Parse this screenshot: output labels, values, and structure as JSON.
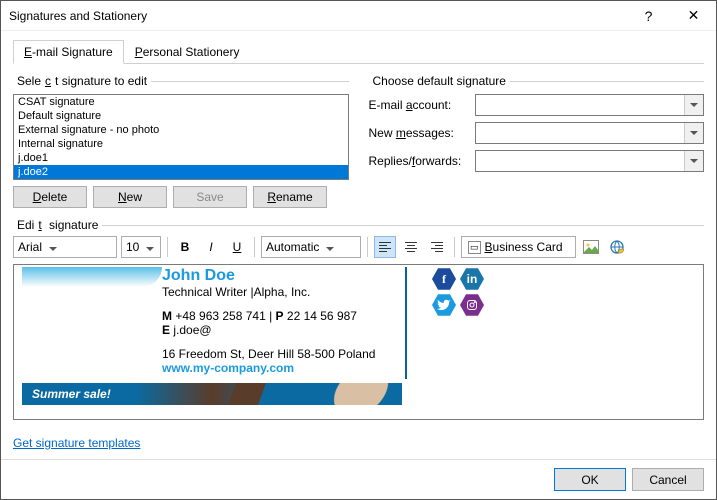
{
  "window": {
    "title": "Signatures and Stationery"
  },
  "tabs": {
    "email": "E-mail Signature",
    "stationery": "Personal Stationery"
  },
  "left_group": {
    "label": "Select signature to edit",
    "items": [
      "CSAT signature",
      "Default signature",
      "External signature - no photo",
      "Internal signature",
      "j.doe1",
      "j.doe2"
    ],
    "selected_index": 5
  },
  "buttons": {
    "delete": "Delete",
    "new": "New",
    "save": "Save",
    "rename": "Rename"
  },
  "right_group": {
    "label": "Choose default signature",
    "email_account": "E-mail account:",
    "new_messages": "New messages:",
    "replies": "Replies/forwards:"
  },
  "edit_label": "Edit signature",
  "toolbar": {
    "font": "Arial",
    "size": "10",
    "color": "Automatic",
    "bizcard": "Business Card"
  },
  "signature": {
    "name": "John Doe",
    "title": "Technical Writer |Alpha, Inc.",
    "phone_line_prefix_m": "M",
    "phone_m": " +48 963 258 741 | ",
    "phone_line_prefix_p": "P",
    "phone_p": " 22 14 56 987",
    "email_prefix": "E",
    "email": " j.doe@",
    "address": "16 Freedom St, Deer Hill 58-500 Poland",
    "website": "www.my-company.com",
    "banner": "Summer sale!"
  },
  "social": {
    "facebook": "f",
    "linkedin": "in",
    "twitter": "t",
    "instagram": "ig"
  },
  "get_templates": "Get signature templates",
  "footer": {
    "ok": "OK",
    "cancel": "Cancel"
  }
}
